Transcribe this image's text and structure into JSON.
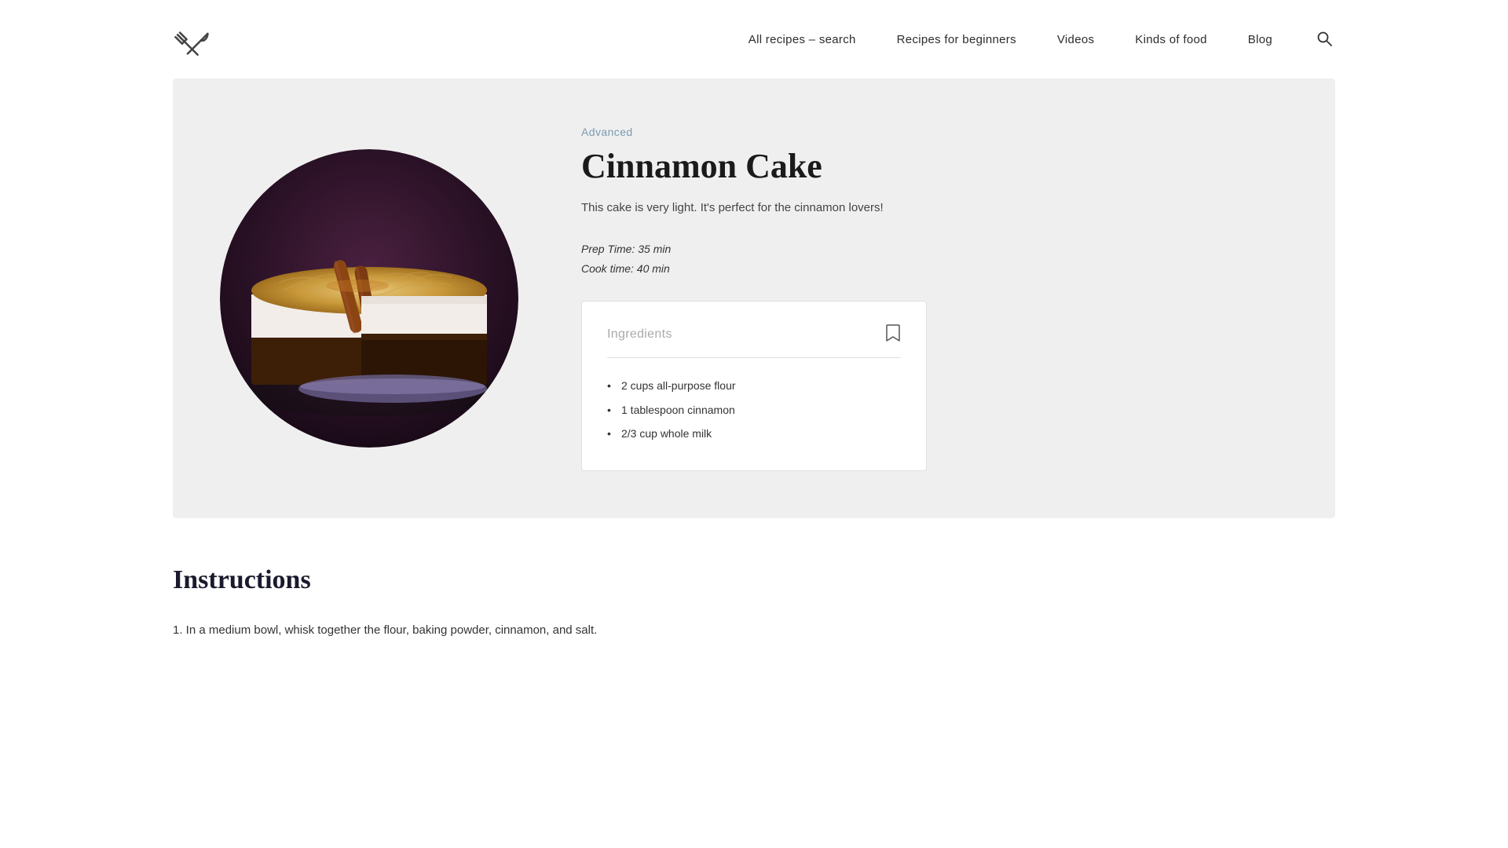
{
  "header": {
    "logo_alt": "Recipe site logo",
    "nav": {
      "items": [
        {
          "label": "All recipes – search",
          "href": "#"
        },
        {
          "label": "Recipes for beginners",
          "href": "#"
        },
        {
          "label": "Videos",
          "href": "#"
        },
        {
          "label": "Kinds of food",
          "href": "#"
        },
        {
          "label": "Blog",
          "href": "#"
        }
      ]
    }
  },
  "recipe": {
    "level": "Advanced",
    "title": "Cinnamon Cake",
    "description": "This cake is very light. It's perfect for the cinnamon lovers!",
    "prep_time": "Prep Time: 35 min",
    "cook_time": "Cook time: 40 min",
    "ingredients_label": "Ingredients",
    "ingredients": [
      "2 cups all-purpose flour",
      "1 tablespoon cinnamon",
      "2/3 cup whole milk"
    ]
  },
  "instructions": {
    "title": "Instructions",
    "steps": [
      "1. In a medium bowl, whisk together the flour, baking powder, cinnamon, and salt."
    ]
  }
}
